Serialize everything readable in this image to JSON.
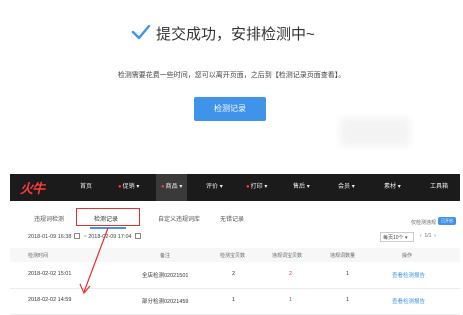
{
  "confirmation": {
    "title": "提交成功，安排检测中~",
    "note": "检测需要花费一些时间，您可以离开页面，之后到【检测记录页面查看】。",
    "button_label": "检测记录"
  },
  "colors": {
    "accent": "#3f93e8",
    "highlight": "#e63030",
    "navbar": "#1b1b1b"
  },
  "app": {
    "logo": "火牛",
    "nav": [
      {
        "label": "首页",
        "dot": false,
        "caret": false
      },
      {
        "label": "促销",
        "dot": true,
        "caret": true
      },
      {
        "label": "商品",
        "dot": true,
        "caret": true,
        "active": true
      },
      {
        "label": "评价",
        "dot": false,
        "caret": true
      },
      {
        "label": "打印",
        "dot": true,
        "caret": true
      },
      {
        "label": "售后",
        "dot": false,
        "caret": true
      },
      {
        "label": "会员",
        "dot": false,
        "caret": true
      },
      {
        "label": "素材",
        "dot": false,
        "caret": true
      },
      {
        "label": "工具箱",
        "dot": false,
        "caret": false
      }
    ],
    "tabs": [
      "违规词检测",
      "检测记录",
      "自定义违规词库",
      "无错记录"
    ],
    "active_tab": "检测记录",
    "right_option": "仅检测违规",
    "toggle_label": "已开启",
    "date_from": "2018-01-09 16:38",
    "date_to": "2018-02-09 17:04",
    "per_page": "每页10个",
    "pager_prev": "‹",
    "pager_page": "1/1",
    "pager_next": "›",
    "columns": [
      "检测时间",
      "备注",
      "检测宝贝数",
      "违规词宝贝数",
      "违规词数量",
      "操作"
    ],
    "rows": [
      {
        "time": "2018-02-02 15:01",
        "remark": "全店检测0202150​1",
        "items": "2",
        "violations": "2",
        "words": "1",
        "action": "查看检测报告"
      },
      {
        "time": "2018-02-02 14:59",
        "remark": "部分检测02021459",
        "items": "1",
        "violations": "1",
        "words": "1",
        "action": "查看检测报告"
      }
    ]
  }
}
